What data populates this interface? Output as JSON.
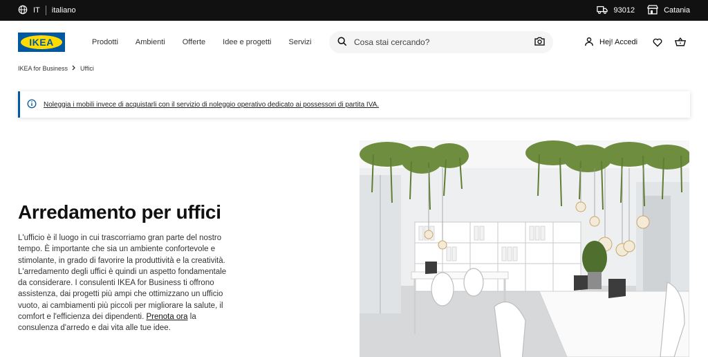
{
  "topbar": {
    "lang_code": "IT",
    "lang_name": "italiano",
    "zip": "93012",
    "store": "Catania"
  },
  "header": {
    "logo_text": "IKEA",
    "nav": [
      "Prodotti",
      "Ambienti",
      "Offerte",
      "Idee e progetti",
      "Servizi"
    ],
    "search_placeholder": "Cosa stai cercando?",
    "account_label": "Hej! Accedi"
  },
  "breadcrumb": {
    "items": [
      "IKEA for Business",
      "Uffici"
    ]
  },
  "notice": {
    "text": "Noleggia i mobili invece di acquistarli con il servizio di noleggio operativo dedicato ai possessori di partita IVA."
  },
  "hero": {
    "title": "Arredamento per uffici",
    "text_before_link": "L'ufficio è il luogo in cui trascorriamo gran parte del nostro tempo. È importante che sia un ambiente confortevole e stimolante, in grado di favorire la produttività e la creatività. L'arredamento degli uffici è quindi un aspetto fondamentale da considerare. I consulenti IKEA for Business ti offrono assistenza, dai progetti più ampi che ottimizzano un ufficio vuoto, ai cambiamenti più piccoli per migliorare la salute, il comfort e l'efficienza dei dipendenti.",
    "link_text": "Prenota ora",
    "text_after_link": "la consulenza d'arredo e dai vita alle tue idee."
  },
  "icons": {
    "globe": "globe-icon",
    "truck": "truck-icon",
    "store": "store-icon",
    "search": "search-icon",
    "camera": "camera-icon",
    "person": "person-icon",
    "heart": "heart-icon",
    "cart": "cart-icon",
    "info": "info-icon",
    "chevron": "chevron-right-icon"
  },
  "colors": {
    "brand_blue": "#0058a3",
    "brand_yellow": "#ffdb00",
    "topbar": "#111111"
  }
}
